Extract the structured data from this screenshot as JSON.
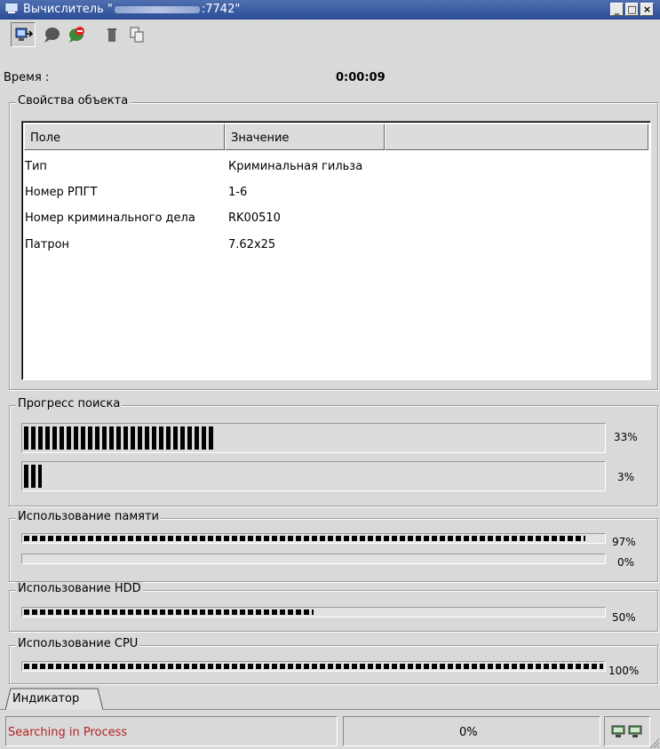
{
  "window": {
    "title_prefix": "Вычислитель \"",
    "title_suffix": ":7742\"",
    "btn_minimize": "_",
    "btn_maximize": "□",
    "btn_close": "×"
  },
  "toolbar": {
    "icons": [
      "connect-icon",
      "chat-icon",
      "stop-icon",
      "delete-icon",
      "copy-icon"
    ]
  },
  "time": {
    "label": "Время :",
    "value": "0:00:09"
  },
  "object_properties": {
    "title": "Свойства объекта",
    "columns": [
      "Поле",
      "Значение",
      ""
    ],
    "rows": [
      [
        "Тип",
        "Криминальная гильза"
      ],
      [
        "Номер РПГТ",
        "1-6"
      ],
      [
        "Номер криминального дела",
        "RK00510"
      ],
      [
        "Патрон",
        "7.62x25"
      ]
    ]
  },
  "search_progress": {
    "title": "Прогресс поиска",
    "bars": [
      {
        "percent_label": "33%",
        "fraction": 0.33
      },
      {
        "percent_label": "3%",
        "fraction": 0.03
      }
    ]
  },
  "memory": {
    "title": "Использование памяти",
    "bars": [
      {
        "percent_label": "97%",
        "fraction": 0.97
      },
      {
        "percent_label": "0%",
        "fraction": 0.0
      }
    ]
  },
  "hdd": {
    "title": "Использование HDD",
    "percent_label": "50%",
    "fraction": 0.5
  },
  "cpu": {
    "title": "Использование CPU",
    "percent_label": "100%",
    "fraction": 1.0
  },
  "tabs": {
    "active": "Индикатор"
  },
  "status": {
    "message": "Searching in Process",
    "percent": "0%",
    "message_color": "#b22222"
  }
}
